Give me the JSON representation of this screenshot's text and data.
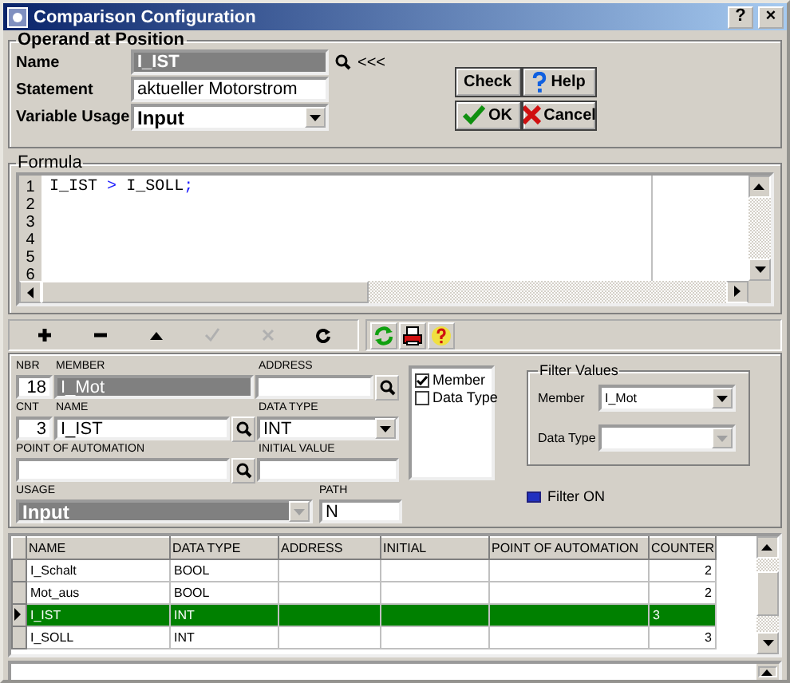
{
  "window": {
    "title": "Comparison Configuration",
    "buttons": [
      "?",
      "×"
    ]
  },
  "operand": {
    "group_title": "Operand at Position",
    "name_label": "Name",
    "name_value": "I_IST",
    "back_link": "<<<",
    "statement_label": "Statement",
    "statement_value": "aktueller Motorstrom",
    "usage_label": "Variable Usage",
    "usage_value": "Input",
    "buttons": [
      {
        "kind": "check",
        "label": "Check"
      },
      {
        "kind": "help",
        "label": "Help"
      },
      {
        "kind": "ok",
        "label": "OK"
      },
      {
        "kind": "cancel",
        "label": "Cancel"
      }
    ]
  },
  "formula": {
    "group_title": "Formula",
    "line_numbers": [
      "1",
      "2",
      "3",
      "4",
      "5",
      "6"
    ],
    "lines": [
      [
        {
          "text": "I_IST",
          "kind": "ident"
        },
        {
          "text": ">",
          "kind": "operator"
        },
        {
          "text": "I_SOLL",
          "kind": "ident"
        },
        {
          "text": ";",
          "kind": "punct"
        }
      ]
    ]
  },
  "toolbar": [
    {
      "kind": "plus",
      "disabled": false
    },
    {
      "kind": "minus",
      "disabled": false
    },
    {
      "kind": "up",
      "disabled": false
    },
    {
      "kind": "check",
      "disabled": true
    },
    {
      "kind": "cross",
      "disabled": true
    },
    {
      "kind": "redo",
      "disabled": false
    }
  ],
  "tool_icons": [
    {
      "kind": "refresh"
    },
    {
      "kind": "print"
    },
    {
      "kind": "help"
    }
  ],
  "detail": {
    "nbr_label": "NBR",
    "nbr_value": "18",
    "member_label": "MEMBER",
    "member_value": "I_Mot",
    "address_label": "ADDRESS",
    "cnt_label": "CNT",
    "cnt_value": "3",
    "name_label": "NAME",
    "name_value": "I_IST",
    "data_type_label": "DATA TYPE",
    "data_type_value": "INT",
    "poa_label": "POINT OF AUTOMATION",
    "initial_label": "INITIAL VALUE",
    "usage_label": "USAGE",
    "usage_value": "Input",
    "path_label": "PATH",
    "path_value": "N"
  },
  "filter_columns": [
    {
      "label": "Member",
      "checked": true
    },
    {
      "label": "Data Type",
      "checked": false
    }
  ],
  "filter_values": {
    "group_title": "Filter Values",
    "member_label": "Member",
    "member_value": "I_Mot",
    "data_type_label": "Data Type",
    "data_type_disabled": true
  },
  "filter_on": {
    "label": "Filter ON",
    "on": true
  },
  "table": {
    "columns": [
      "NAME",
      "DATA TYPE",
      "ADDRESS",
      "INITIAL",
      "POINT OF AUTOMATION",
      "COUNTER"
    ],
    "rows": [
      {
        "cells": [
          "I_Schalt",
          "BOOL",
          "",
          "",
          "",
          "2"
        ],
        "selected": false
      },
      {
        "cells": [
          "Mot_aus",
          "BOOL",
          "",
          "",
          "",
          "2"
        ],
        "selected": false
      },
      {
        "cells": [
          "I_IST",
          "INT",
          "",
          "",
          "",
          "3"
        ],
        "selected": true
      },
      {
        "cells": [
          "I_SOLL",
          "INT",
          "",
          "",
          "",
          "3"
        ],
        "selected": false
      }
    ]
  }
}
